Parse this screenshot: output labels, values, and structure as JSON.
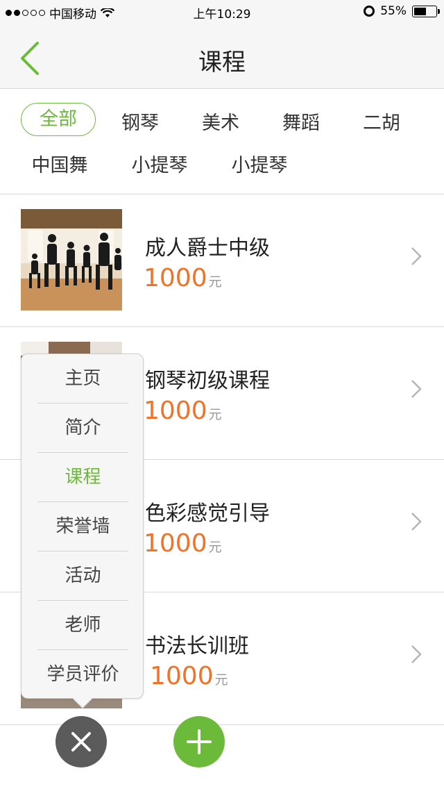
{
  "status_bar": {
    "carrier": "中国移动",
    "time": "上午10:29",
    "battery": "55%",
    "battery_level": 0.55
  },
  "nav": {
    "title": "课程"
  },
  "categories": [
    "全部",
    "钢琴",
    "美术",
    "舞蹈",
    "二胡",
    "中国舞",
    "小提琴",
    "小提琴"
  ],
  "courses": [
    {
      "title": "成人爵士中级",
      "price": "1000",
      "unit": "元"
    },
    {
      "title": "钢琴初级课程",
      "price": "1000",
      "unit": "元"
    },
    {
      "title": "色彩感觉引导",
      "price": "1000",
      "unit": "元"
    },
    {
      "title": "书法长训班",
      "price": "1000",
      "unit": "元"
    }
  ],
  "menu": {
    "items": [
      "主页",
      "简介",
      "课程",
      "荣誉墙",
      "活动",
      "老师",
      "学员评价"
    ],
    "active_item": "课程"
  },
  "colors": {
    "accent": "#6cba3a",
    "price": "#f0732a",
    "close_button": "#5b5b5b"
  },
  "icons": {
    "back": "back-chevron-icon",
    "row_arrow": "chevron-right-icon",
    "close": "close-icon",
    "add": "plus-icon",
    "wifi": "wifi-icon",
    "alarm": "alarm-icon"
  }
}
